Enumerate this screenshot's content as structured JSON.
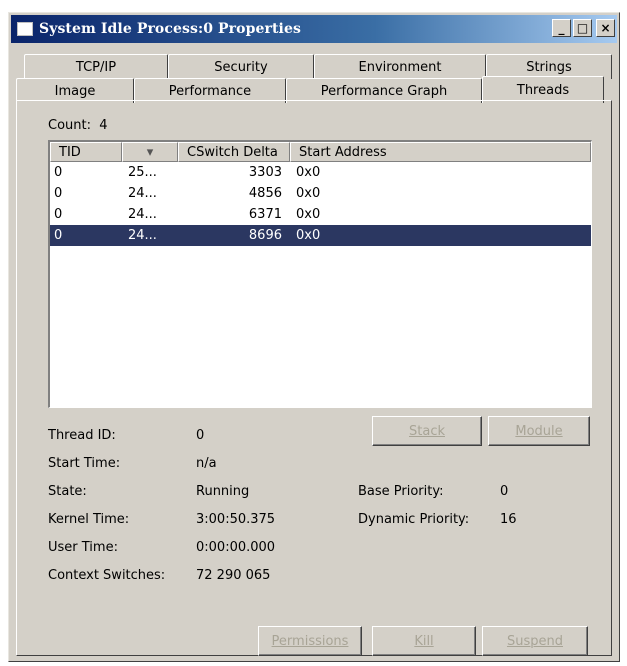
{
  "window": {
    "title": "System Idle Process:0 Properties",
    "minimize": "_",
    "maximize": "□",
    "close": "×"
  },
  "tabs": {
    "top": [
      "TCP/IP",
      "Security",
      "Environment",
      "Strings"
    ],
    "bottom": [
      "Image",
      "Performance",
      "Performance Graph",
      "Threads"
    ],
    "active": "Threads"
  },
  "count": {
    "label": "Count:",
    "value": "4"
  },
  "table": {
    "headers": [
      "TID",
      "▾",
      "CSwitch Delta",
      "Start Address"
    ],
    "rows": [
      {
        "tid": "0",
        "cpu": "25...",
        "cswitch": "3303",
        "start": "0x0"
      },
      {
        "tid": "0",
        "cpu": "24...",
        "cswitch": "4856",
        "start": "0x0"
      },
      {
        "tid": "0",
        "cpu": "24...",
        "cswitch": "6371",
        "start": "0x0"
      },
      {
        "tid": "0",
        "cpu": "24...",
        "cswitch": "8696",
        "start": "0x0"
      }
    ],
    "selected_row": 3
  },
  "details": {
    "thread_id_label": "Thread ID:",
    "thread_id": "0",
    "start_time_label": "Start Time:",
    "start_time": "n/a",
    "state_label": "State:",
    "state": "Running",
    "kernel_time_label": "Kernel Time:",
    "kernel_time": "3:00:50.375",
    "user_time_label": "User Time:",
    "user_time": "0:00:00.000",
    "context_switches_label": "Context Switches:",
    "context_switches": "72 290 065",
    "base_priority_label": "Base Priority:",
    "base_priority": "0",
    "dynamic_priority_label": "Dynamic Priority:",
    "dynamic_priority": "16"
  },
  "buttons": {
    "stack": "Stack",
    "module": "Module",
    "permissions": "Permissions",
    "kill": "Kill",
    "suspend": "Suspend"
  },
  "colors": {
    "title_bar": "#0a246a",
    "selection": "#2b3761",
    "face": "#d4d0c8"
  }
}
